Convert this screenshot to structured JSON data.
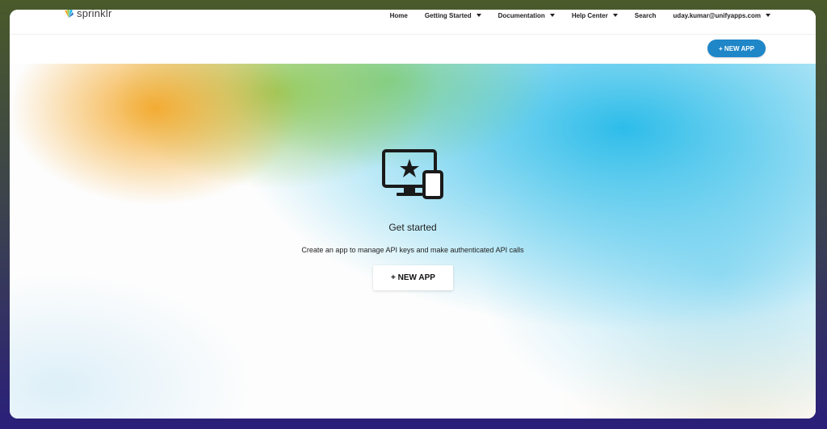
{
  "brand": {
    "name": "sprinklr",
    "logo_icon": "sprinklr-logo-icon"
  },
  "nav": {
    "items": [
      {
        "label": "Home",
        "has_dropdown": false
      },
      {
        "label": "Getting Started",
        "has_dropdown": true
      },
      {
        "label": "Documentation",
        "has_dropdown": true
      },
      {
        "label": "Help Center",
        "has_dropdown": true
      },
      {
        "label": "Search",
        "has_dropdown": false
      },
      {
        "label": "uday.kumar@unifyapps.com",
        "has_dropdown": true
      }
    ]
  },
  "toolbar": {
    "new_app_label": "+ NEW APP"
  },
  "hero": {
    "icon": "monitor-mobile-star-icon",
    "title": "Get started",
    "subtitle": "Create an app to manage API keys and make authenticated API calls",
    "cta_label": "+ NEW APP"
  },
  "colors": {
    "accent": "#1f86c8",
    "gradient_orange": "#f4a82a",
    "gradient_green": "#8cc448",
    "gradient_blue": "#22b9e8"
  }
}
